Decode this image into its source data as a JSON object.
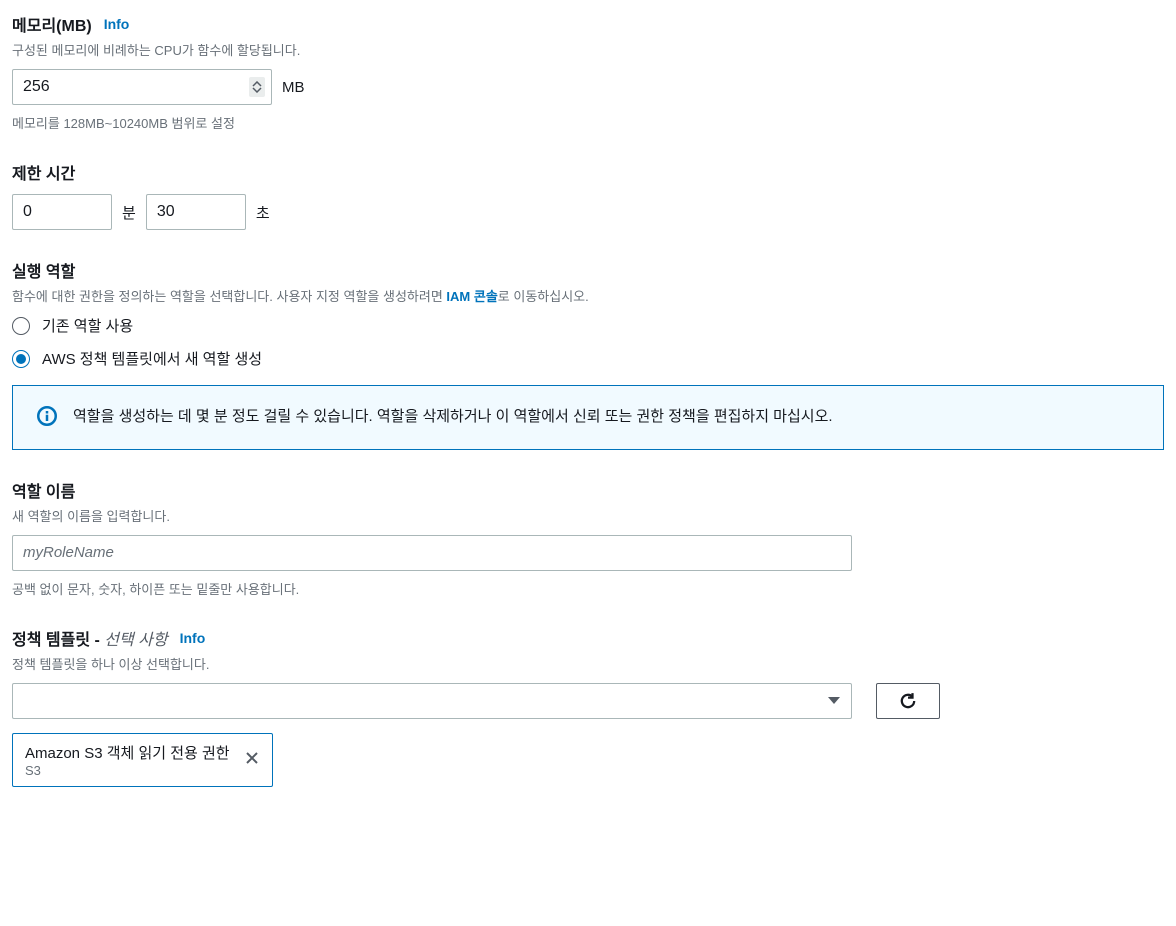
{
  "memory": {
    "label": "메모리(MB)",
    "info": "Info",
    "description": "구성된 메모리에 비례하는 CPU가 함수에 할당됩니다.",
    "value": "256",
    "unit": "MB",
    "hint": "메모리를 128MB~10240MB 범위로 설정"
  },
  "timeout": {
    "label": "제한 시간",
    "minutes_value": "0",
    "minutes_unit": "분",
    "seconds_value": "30",
    "seconds_unit": "초"
  },
  "role": {
    "label": "실행 역할",
    "description_prefix": "함수에 대한 권한을 정의하는 역할을 선택합니다. 사용자 지정 역할을 생성하려면 ",
    "iam_link": "IAM 콘솔",
    "description_suffix": "로 이동하십시오.",
    "options": {
      "existing": "기존 역할 사용",
      "template": "AWS 정책 템플릿에서 새 역할 생성"
    },
    "info_box": "역할을 생성하는 데 몇 분 정도 걸릴 수 있습니다. 역할을 삭제하거나 이 역할에서 신뢰 또는 권한 정책을 편집하지 마십시오."
  },
  "role_name": {
    "label": "역할 이름",
    "description": "새 역할의 이름을 입력합니다.",
    "placeholder": "myRoleName",
    "hint": "공백 없이 문자, 숫자, 하이픈 또는 밑줄만 사용합니다."
  },
  "policy": {
    "label": "정책 템플릿",
    "optional": "선택 사항",
    "info": "Info",
    "description": "정책 템플릿을 하나 이상 선택합니다.",
    "dash": " - ",
    "selected": {
      "title": "Amazon S3 객체 읽기 전용 권한",
      "sub": "S3"
    }
  }
}
